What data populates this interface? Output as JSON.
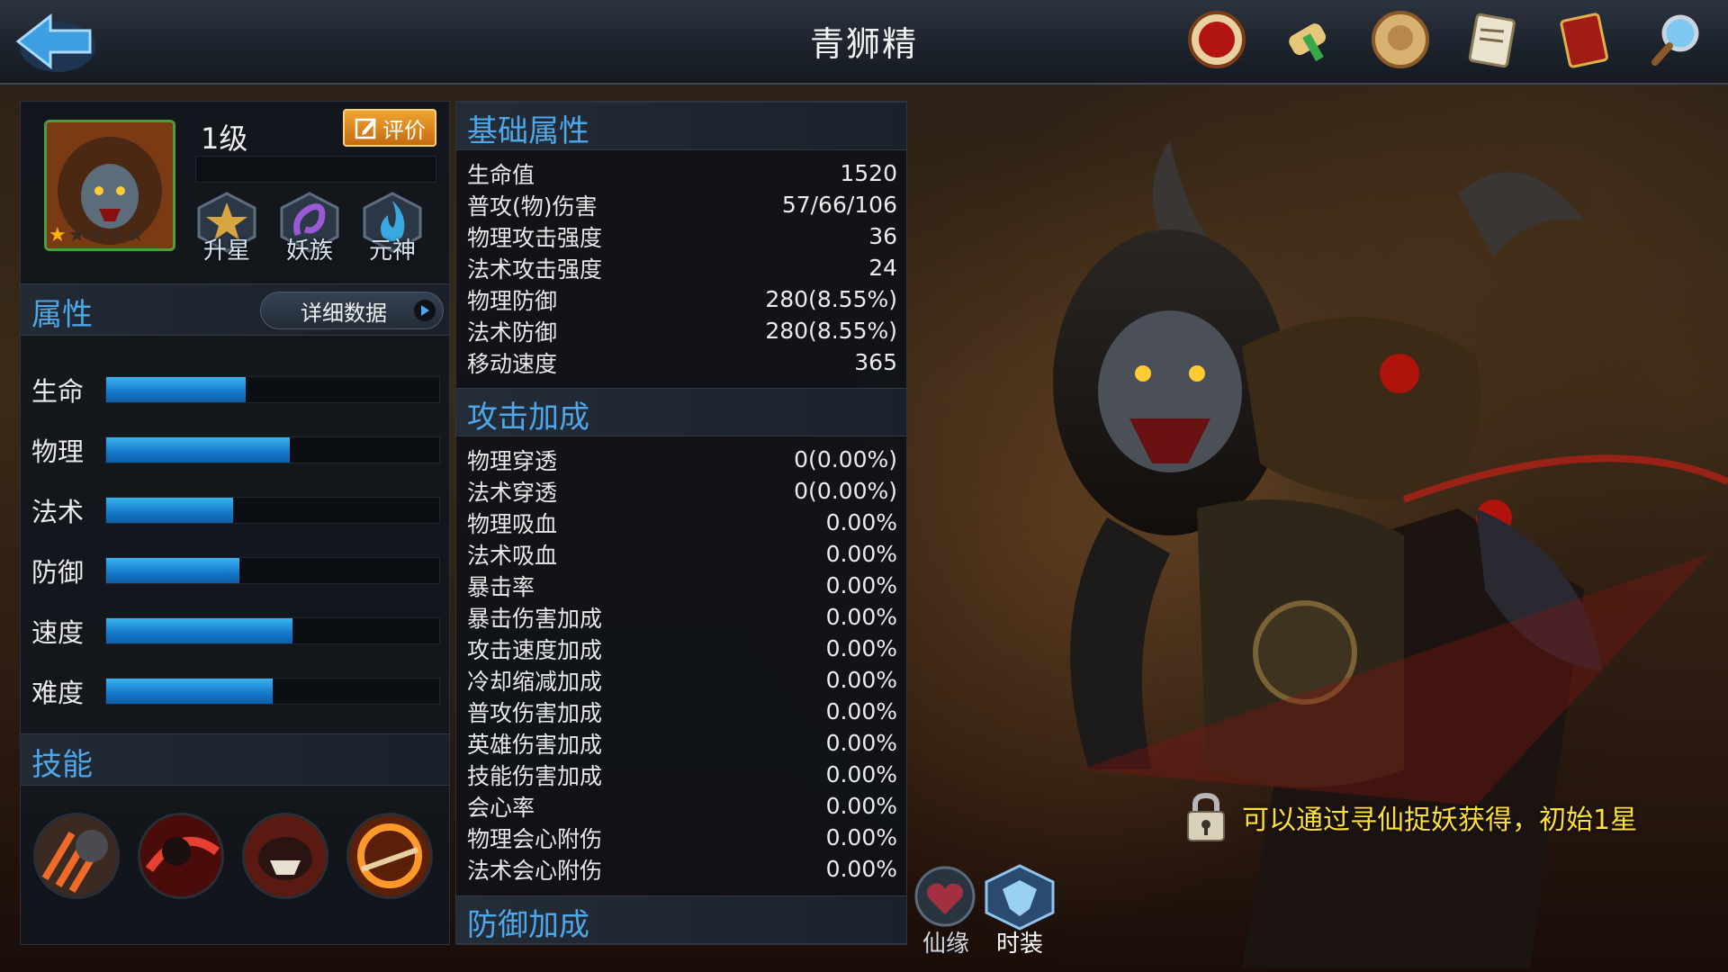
{
  "header": {
    "title": "青狮精"
  },
  "hero": {
    "level": "1级",
    "rate_label": "评价",
    "stars_total": 5,
    "stars_filled": 1,
    "badges": [
      {
        "label": "升星",
        "icon": "star-upgrade-icon"
      },
      {
        "label": "妖族",
        "icon": "demon-clan-icon"
      },
      {
        "label": "元神",
        "icon": "soul-flame-icon"
      }
    ]
  },
  "attributes": {
    "title": "属性",
    "detail_label": "详细数据",
    "rows": [
      {
        "label": "生命",
        "value": 0.42
      },
      {
        "label": "物理",
        "value": 0.55
      },
      {
        "label": "法术",
        "value": 0.38
      },
      {
        "label": "防御",
        "value": 0.4
      },
      {
        "label": "速度",
        "value": 0.56
      },
      {
        "label": "难度",
        "value": 0.5
      }
    ]
  },
  "skills": {
    "title": "技能",
    "items": [
      {
        "icon": "claw-strike-skill-icon"
      },
      {
        "icon": "crimson-slash-skill-icon"
      },
      {
        "icon": "roar-skill-icon"
      },
      {
        "icon": "blade-sweep-skill-icon"
      }
    ]
  },
  "base_stats": {
    "title": "基础属性",
    "rows": [
      {
        "label": "生命值",
        "value": "1520"
      },
      {
        "label": "普攻(物)伤害",
        "value": "57/66/106"
      },
      {
        "label": "物理攻击强度",
        "value": "36"
      },
      {
        "label": "法术攻击强度",
        "value": "24"
      },
      {
        "label": "物理防御",
        "value": "280(8.55%)"
      },
      {
        "label": "法术防御",
        "value": "280(8.55%)"
      },
      {
        "label": "移动速度",
        "value": "365"
      }
    ]
  },
  "attack_bonus": {
    "title": "攻击加成",
    "rows": [
      {
        "label": "物理穿透",
        "value": "0(0.00%)"
      },
      {
        "label": "法术穿透",
        "value": "0(0.00%)"
      },
      {
        "label": "物理吸血",
        "value": "0.00%"
      },
      {
        "label": "法术吸血",
        "value": "0.00%"
      },
      {
        "label": "暴击率",
        "value": "0.00%"
      },
      {
        "label": "暴击伤害加成",
        "value": "0.00%"
      },
      {
        "label": "攻击速度加成",
        "value": "0.00%"
      },
      {
        "label": "冷却缩减加成",
        "value": "0.00%"
      },
      {
        "label": "普攻伤害加成",
        "value": "0.00%"
      },
      {
        "label": "英雄伤害加成",
        "value": "0.00%"
      },
      {
        "label": "技能伤害加成",
        "value": "0.00%"
      },
      {
        "label": "会心率",
        "value": "0.00%"
      },
      {
        "label": "物理会心附伤",
        "value": "0.00%"
      },
      {
        "label": "法术会心附伤",
        "value": "0.00%"
      }
    ]
  },
  "defense_bonus": {
    "title": "防御加成"
  },
  "bottom_tabs": [
    {
      "label": "仙缘",
      "icon": "heart-bond-icon"
    },
    {
      "label": "时装",
      "icon": "costume-icon"
    }
  ],
  "unlock": {
    "text": "可以通过寻仙捉妖获得，初始1星"
  },
  "top_icons": [
    "trial-seal-icon",
    "scroll-icon",
    "token-coin-icon",
    "document-icon",
    "codex-book-icon",
    "magnifier-icon"
  ]
}
